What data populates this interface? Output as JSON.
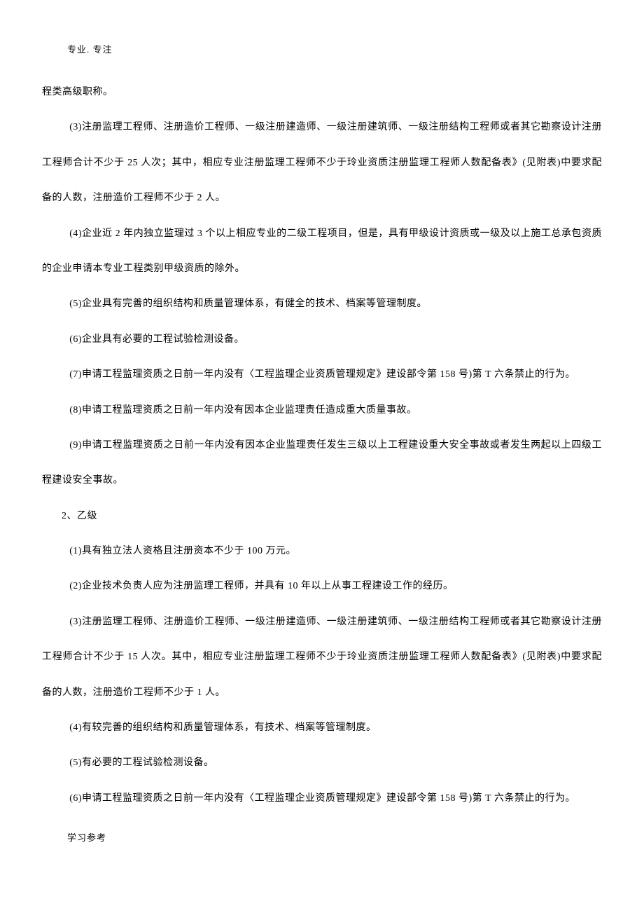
{
  "header": "专业. 专注",
  "footer": "学习参考",
  "paragraphs": [
    {
      "indent": false,
      "text": "程类高级职称。"
    },
    {
      "indent": true,
      "text": "(3)注册监理工程师、注册造价工程师、一级注册建造师、一级注册建筑师、一级注册结构工程师或者其它勘察设计注册工程师合计不少于 25 人次；其中，相应专业注册监理工程师不少于玲业资质注册监理工程师人数配备表》(见附表)中要求配备的人数，注册造价工程师不少于 2 人。"
    },
    {
      "indent": true,
      "text": "(4)企业近 2 年内独立监理过 3 个以上相应专业的二级工程项目，但是，具有甲级设计资质或一级及以上施工总承包资质的企业申请本专业工程类别甲级资质的除外。"
    },
    {
      "indent": true,
      "text": "(5)企业具有完善的组织结构和质量管理体系，有健全的技术、档案等管理制度。"
    },
    {
      "indent": true,
      "text": "(6)企业具有必要的工程试验检测设备。"
    },
    {
      "indent": true,
      "text": "(7)申请工程监理资质之日前一年内没有〈工程监理企业资质管理规定》建设部令第 158 号)第 T 六条禁止的行为。"
    },
    {
      "indent": true,
      "text": "(8)申请工程监理资质之日前一年内没有因本企业监理责任造成重大质量事故。"
    },
    {
      "indent": true,
      "text": "(9)申请工程监理资质之日前一年内没有因本企业监理责任发生三级以上工程建设重大安全事故或者发生两起以上四级工程建设安全事故。"
    },
    {
      "indent": true,
      "small": true,
      "text": "2、乙级"
    },
    {
      "indent": true,
      "text": "(1)具有独立法人资格且注册资本不少于 100 万元。"
    },
    {
      "indent": true,
      "text": "(2)企业技术负责人应为注册监理工程师，并具有 10 年以上从事工程建设工作的经历。"
    },
    {
      "indent": true,
      "text": "(3)注册监理工程师、注册造价工程师、一级注册建造师、一级注册建筑师、一级注册结构工程师或者其它勘察设计注册工程师合计不少于 15 人次。其中，相应专业注册监理工程师不少于玲业资质注册监理工程师人数配备表》(见附表)中要求配备的人数，注册造价工程师不少于 1 人。"
    },
    {
      "indent": true,
      "text": "(4)有较完善的组织结构和质量管理体系，有技术、档案等管理制度。"
    },
    {
      "indent": true,
      "text": "(5)有必要的工程试验检测设备。"
    },
    {
      "indent": true,
      "text": "(6)申请工程监理资质之日前一年内没有〈工程监理企业资质管理规定》建设部令第 158 号)第 T 六条禁止的行为。"
    }
  ]
}
